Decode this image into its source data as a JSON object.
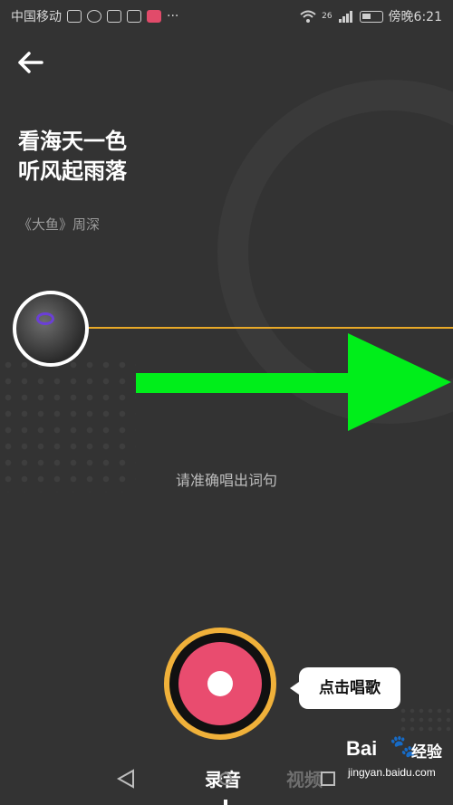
{
  "status_bar": {
    "carrier": "中国移动",
    "signal_badge": "26",
    "time": "傍晚6:21",
    "more": "···"
  },
  "song": {
    "lyric_line_1": "看海天一色",
    "lyric_line_2": "听风起雨落",
    "title_artist": "《大鱼》周深"
  },
  "hint_text": "请准确唱出词句",
  "record_tooltip": "点击唱歌",
  "tabs": {
    "record": "录音",
    "video": "视频"
  },
  "watermark": {
    "logo": "Bai",
    "label": "经验",
    "url": "jingyan.baidu.com"
  },
  "colors": {
    "background": "#333333",
    "accent_orange": "#f0b13a",
    "record_pink": "#e94c6f",
    "arrow_green": "#00ee1a",
    "pitch_line": "#e8a928"
  },
  "icons": {
    "back": "back-arrow-icon",
    "nav_back": "triangle-back-icon",
    "nav_home": "circle-home-icon",
    "nav_recent": "square-recent-icon"
  }
}
